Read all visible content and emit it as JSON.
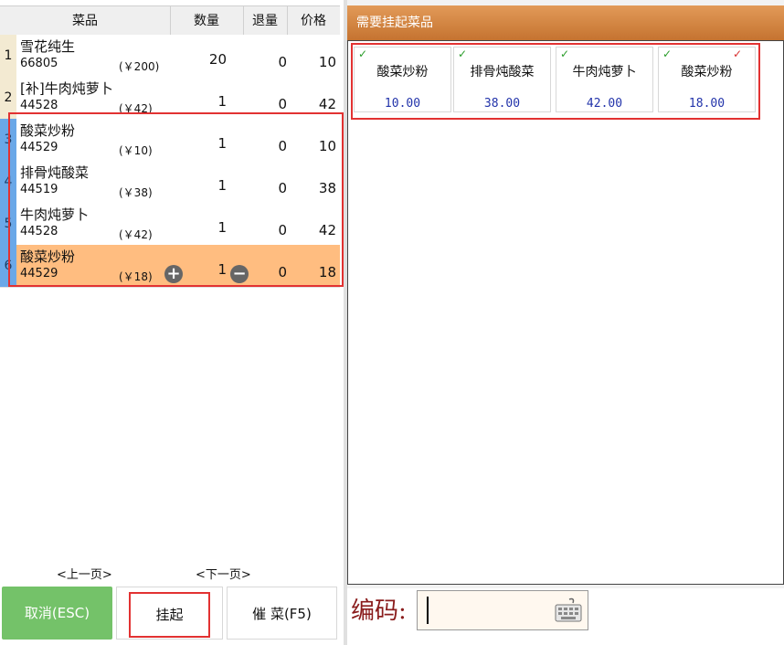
{
  "order_table": {
    "headers": {
      "name": "菜品",
      "qty": "数量",
      "returned": "退量",
      "price": "价格"
    },
    "rows": [
      {
        "index": "1",
        "name": "雪花纯生",
        "code": "66805",
        "unit_price": "(￥200)",
        "qty": "20",
        "returned": "0",
        "price": "10"
      },
      {
        "index": "2",
        "name": "[补]牛肉炖萝卜",
        "code": "44528",
        "unit_price": "(￥42)",
        "qty": "1",
        "returned": "0",
        "price": "42"
      },
      {
        "index": "3",
        "name": "酸菜炒粉",
        "code": "44529",
        "unit_price": "(￥10)",
        "qty": "1",
        "returned": "0",
        "price": "10"
      },
      {
        "index": "4",
        "name": "排骨炖酸菜",
        "code": "44519",
        "unit_price": "(￥38)",
        "qty": "1",
        "returned": "0",
        "price": "38"
      },
      {
        "index": "5",
        "name": "牛肉炖萝卜",
        "code": "44528",
        "unit_price": "(￥42)",
        "qty": "1",
        "returned": "0",
        "price": "42"
      },
      {
        "index": "6",
        "name": "酸菜炒粉",
        "code": "44529",
        "unit_price": "(￥18)",
        "qty": "1",
        "returned": "0",
        "price": "18"
      }
    ],
    "plus_icon": "+",
    "minus_icon": "−"
  },
  "pager": {
    "prev": "<上一页>",
    "next": "<下一页>"
  },
  "buttons": {
    "cancel": "取消(ESC)",
    "suspend": "挂起",
    "rush": "催 菜(F5)"
  },
  "suspend_panel": {
    "title": "需要挂起菜品",
    "tick": "✓",
    "items": [
      {
        "name": "酸菜炒粉",
        "price": "10.00"
      },
      {
        "name": "排骨炖酸菜",
        "price": "38.00"
      },
      {
        "name": "牛肉炖萝卜",
        "price": "42.00"
      },
      {
        "name": "酸菜炒粉",
        "price": "18.00"
      }
    ]
  },
  "code_entry": {
    "label": "编码:",
    "value": ""
  },
  "colors": {
    "header_orange": "#d07f3c",
    "selected_row": "#ffbd80",
    "cancel_green": "#74c269",
    "highlight_red": "#e23232"
  }
}
